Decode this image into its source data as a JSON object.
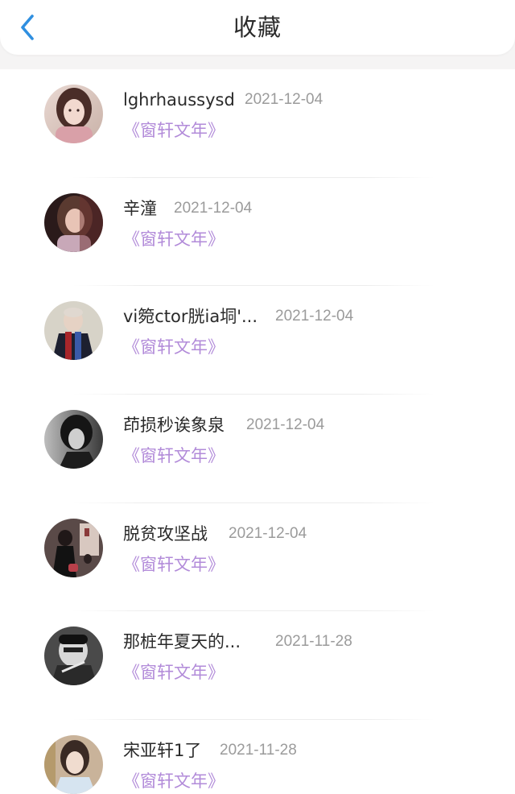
{
  "header": {
    "title": "收藏",
    "back_icon": "chevron-left-icon",
    "accent_color": "#2f8fe0"
  },
  "colors": {
    "book_title": "#b28bd9",
    "date": "#9b9b9b"
  },
  "favorites": [
    {
      "user": "lghrhaussysd",
      "date": "2021-12-04",
      "book": "《窗轩文年》"
    },
    {
      "user": "辛潼",
      "date": "2021-12-04",
      "book": "《窗轩文年》"
    },
    {
      "user": "vi箢ctor胱ia垌'...",
      "date": "2021-12-04",
      "book": "《窗轩文年》"
    },
    {
      "user": "茚损秒诶象泉",
      "date": "2021-12-04",
      "book": "《窗轩文年》"
    },
    {
      "user": "脱贫攻坚战",
      "date": "2021-12-04",
      "book": "《窗轩文年》"
    },
    {
      "user": "那桩年夏天的...",
      "date": "2021-11-28",
      "book": "《窗轩文年》"
    },
    {
      "user": "宋亚轩1了",
      "date": "2021-11-28",
      "book": "《窗轩文年》"
    }
  ]
}
